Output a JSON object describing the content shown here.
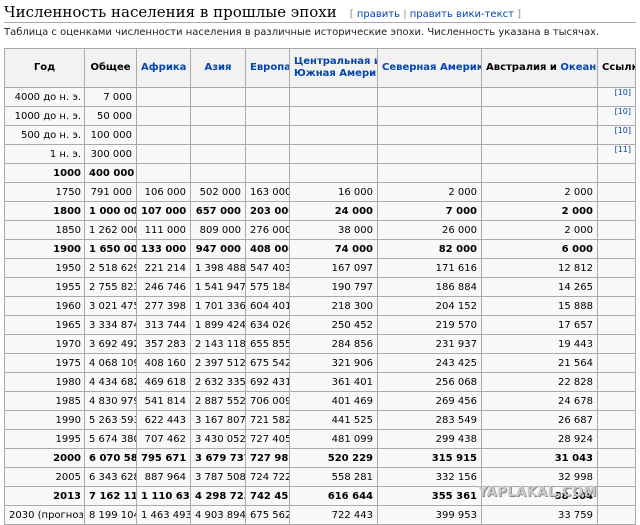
{
  "header": {
    "title": "Численность населения в прошлые эпохи",
    "edit_link": "править",
    "edit_source_link": "править вики-текст"
  },
  "description": "Таблица с оценками численности населения в различные исторические эпохи. Численность указана в тысячах.",
  "table": {
    "headers": {
      "year": "Год",
      "total": "Общее",
      "africa": "Африка",
      "asia": "Азия",
      "europe": "Европа",
      "latin_line1": "Центральная и",
      "latin_line2": "Южная Америка",
      "north_america": "Северная Америка*",
      "oceania_prefix": "Австралия и ",
      "oceania_link": "Океания",
      "refs": "Ссылки"
    },
    "rows": [
      {
        "year": "4000 до н. э.",
        "total": "7 000",
        "africa": "",
        "asia": "",
        "europe": "",
        "latin": "",
        "north": "",
        "oceania": "",
        "ref": "[10]",
        "bold": false
      },
      {
        "year": "1000 до н. э.",
        "total": "50 000",
        "africa": "",
        "asia": "",
        "europe": "",
        "latin": "",
        "north": "",
        "oceania": "",
        "ref": "[10]",
        "bold": false
      },
      {
        "year": "500 до н. э.",
        "total": "100 000",
        "africa": "",
        "asia": "",
        "europe": "",
        "latin": "",
        "north": "",
        "oceania": "",
        "ref": "[10]",
        "bold": false
      },
      {
        "year": "1 н. э.",
        "total": "300 000",
        "africa": "",
        "asia": "",
        "europe": "",
        "latin": "",
        "north": "",
        "oceania": "",
        "ref": "[11]",
        "bold": false
      },
      {
        "year": "1000",
        "total": "400 000",
        "africa": "",
        "asia": "",
        "europe": "",
        "latin": "",
        "north": "",
        "oceania": "",
        "ref": "",
        "bold": true
      },
      {
        "year": "1750",
        "total": "791 000",
        "africa": "106 000",
        "asia": "502 000",
        "europe": "163 000",
        "latin": "16 000",
        "north": "2 000",
        "oceania": "2 000",
        "ref": "",
        "bold": false
      },
      {
        "year": "1800",
        "total": "1 000 000",
        "africa": "107 000",
        "asia": "657 000",
        "europe": "203 000",
        "latin": "24 000",
        "north": "7 000",
        "oceania": "2 000",
        "ref": "",
        "bold": true
      },
      {
        "year": "1850",
        "total": "1 262 000",
        "africa": "111 000",
        "asia": "809 000",
        "europe": "276 000",
        "latin": "38 000",
        "north": "26 000",
        "oceania": "2 000",
        "ref": "",
        "bold": false
      },
      {
        "year": "1900",
        "total": "1 650 000",
        "africa": "133 000",
        "asia": "947 000",
        "europe": "408 000",
        "latin": "74 000",
        "north": "82 000",
        "oceania": "6 000",
        "ref": "",
        "bold": true
      },
      {
        "year": "1950",
        "total": "2 518 629",
        "africa": "221 214",
        "asia": "1 398 488",
        "europe": "547 403",
        "latin": "167 097",
        "north": "171 616",
        "oceania": "12 812",
        "ref": "",
        "bold": false
      },
      {
        "year": "1955",
        "total": "2 755 823",
        "africa": "246 746",
        "asia": "1 541 947",
        "europe": "575 184",
        "latin": "190 797",
        "north": "186 884",
        "oceania": "14 265",
        "ref": "",
        "bold": false
      },
      {
        "year": "1960",
        "total": "3 021 475",
        "africa": "277 398",
        "asia": "1 701 336",
        "europe": "604 401",
        "latin": "218 300",
        "north": "204 152",
        "oceania": "15 888",
        "ref": "",
        "bold": false
      },
      {
        "year": "1965",
        "total": "3 334 874",
        "africa": "313 744",
        "asia": "1 899 424",
        "europe": "634 026",
        "latin": "250 452",
        "north": "219 570",
        "oceania": "17 657",
        "ref": "",
        "bold": false
      },
      {
        "year": "1970",
        "total": "3 692 492",
        "africa": "357 283",
        "asia": "2 143 118",
        "europe": "655 855",
        "latin": "284 856",
        "north": "231 937",
        "oceania": "19 443",
        "ref": "",
        "bold": false
      },
      {
        "year": "1975",
        "total": "4 068 109",
        "africa": "408 160",
        "asia": "2 397 512",
        "europe": "675 542",
        "latin": "321 906",
        "north": "243 425",
        "oceania": "21 564",
        "ref": "",
        "bold": false
      },
      {
        "year": "1980",
        "total": "4 434 682",
        "africa": "469 618",
        "asia": "2 632 335",
        "europe": "692 431",
        "latin": "361 401",
        "north": "256 068",
        "oceania": "22 828",
        "ref": "",
        "bold": false
      },
      {
        "year": "1985",
        "total": "4 830 979",
        "africa": "541 814",
        "asia": "2 887 552",
        "europe": "706 009",
        "latin": "401 469",
        "north": "269 456",
        "oceania": "24 678",
        "ref": "",
        "bold": false
      },
      {
        "year": "1990",
        "total": "5 263 593",
        "africa": "622 443",
        "asia": "3 167 807",
        "europe": "721 582",
        "latin": "441 525",
        "north": "283 549",
        "oceania": "26 687",
        "ref": "",
        "bold": false
      },
      {
        "year": "1995",
        "total": "5 674 380",
        "africa": "707 462",
        "asia": "3 430 052",
        "europe": "727 405",
        "latin": "481 099",
        "north": "299 438",
        "oceania": "28 924",
        "ref": "",
        "bold": false
      },
      {
        "year": "2000",
        "total": "6 070 581",
        "africa": "795 671",
        "asia": "3 679 737",
        "europe": "727 986",
        "latin": "520 229",
        "north": "315 915",
        "oceania": "31 043",
        "ref": "",
        "bold": true
      },
      {
        "year": "2005",
        "total": "6 343 628",
        "africa": "887 964",
        "asia": "3 787 508",
        "europe": "724 722",
        "latin": "558 281",
        "north": "332 156",
        "oceania": "32 998",
        "ref": "",
        "bold": false
      },
      {
        "year": "2013",
        "total": "7 162 119",
        "africa": "1 110 635",
        "asia": "4 298 723",
        "europe": "742 452",
        "latin": "616 644",
        "north": "355 361",
        "oceania": "38 304",
        "ref": "",
        "bold": true
      },
      {
        "year": "2030 (прогноз)",
        "total": "8 199 104",
        "africa": "1 463 493",
        "asia": "4 903 894",
        "europe": "675 562",
        "latin": "722 443",
        "north": "399 953",
        "oceania": "33 759",
        "ref": "",
        "bold": false
      }
    ]
  },
  "watermark": "YAPLAKAL.COM",
  "colors": {
    "link": "#0645ad",
    "border": "#aaaaaa",
    "header_bg": "#f2f2f2"
  }
}
